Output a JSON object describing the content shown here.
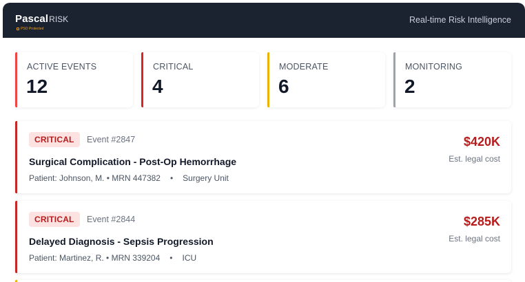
{
  "brand": {
    "name": "Pascal",
    "suffix": "RISK",
    "badge": "PSO Protected"
  },
  "header": {
    "tagline": "Real-time Risk Intelligence"
  },
  "stats": [
    {
      "label": "ACTIVE EVENTS",
      "value": "12",
      "color": "#ef4444"
    },
    {
      "label": "CRITICAL",
      "value": "4",
      "color": "#dc2626"
    },
    {
      "label": "MODERATE",
      "value": "6",
      "color": "#eab308"
    },
    {
      "label": "MONITORING",
      "value": "2",
      "color": "#9ca3af"
    }
  ],
  "events": [
    {
      "severity": "CRITICAL",
      "id": "Event #2847",
      "title": "Surgical Complication - Post-Op Hemorrhage",
      "patient": "Patient: Johnson, M. • MRN 447382",
      "bullet": "•",
      "unit": "Surgery Unit",
      "cost": "$420K",
      "cost_label": "Est. legal cost"
    },
    {
      "severity": "CRITICAL",
      "id": "Event #2844",
      "title": "Delayed Diagnosis - Sepsis Progression",
      "patient": "Patient: Martinez, R. • MRN 339204",
      "bullet": "•",
      "unit": "ICU",
      "cost": "$285K",
      "cost_label": "Est. legal cost"
    }
  ],
  "colors": {
    "header_bg": "#1b2230",
    "critical": "#c62828",
    "critical_badge_bg": "#fde2e2",
    "moderate": "#eab308"
  }
}
